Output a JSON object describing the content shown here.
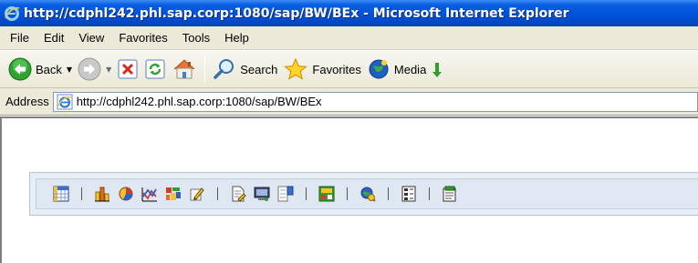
{
  "window": {
    "title": "http://cdphl242.phl.sap.corp:1080/sap/BW/BEx - Microsoft Internet Explorer"
  },
  "menubar": {
    "items": [
      "File",
      "Edit",
      "View",
      "Favorites",
      "Tools",
      "Help"
    ]
  },
  "toolbar": {
    "back_label": "Back",
    "search_label": "Search",
    "favorites_label": "Favorites",
    "media_label": "Media"
  },
  "address": {
    "label": "Address",
    "url": "http://cdphl242.phl.sap.corp:1080/sap/BW/BEx"
  },
  "bex_toolbar": {
    "icons": [
      "table-icon",
      "separator",
      "bar-chart-icon",
      "pie-chart-icon",
      "line-chart-icon",
      "map-icon",
      "pencil-icon",
      "separator",
      "document-icon",
      "monitor-icon",
      "tree-icon",
      "separator",
      "alert-grid-icon",
      "separator",
      "search-query-icon",
      "separator",
      "list-icon",
      "separator",
      "export-icon"
    ]
  },
  "colors": {
    "titlebar_blue": "#0052d9",
    "chrome_beige": "#ece9d8",
    "bex_panel": "#e8eef6"
  }
}
